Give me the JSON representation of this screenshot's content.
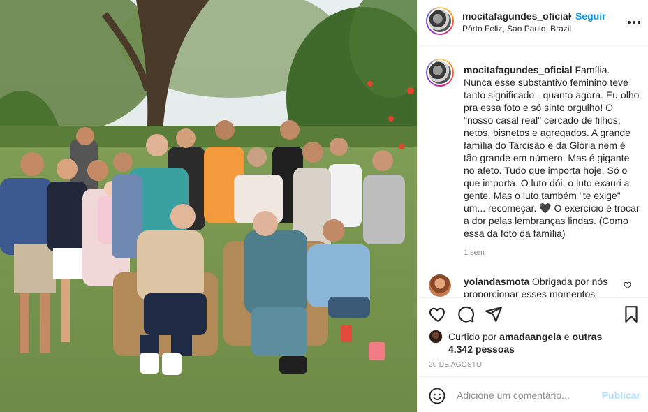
{
  "post": {
    "username": "mocitafagundes_oficial",
    "separator": "•",
    "follow_label": "Seguir",
    "location": "Pôrto Feliz, Sao Paulo, Brazil",
    "more_icon": "more-options-icon"
  },
  "caption": {
    "username": "mocitafagundes_oficial",
    "text": "Família. Nunca esse substantivo feminino teve tanto significado - quanto agora. Eu olho pra essa foto e só sinto orgulho! O \"nosso casal real\" cercado de filhos, netos, bisnetos e agregados. A grande família do Tarcisão e da Glória nem é tão grande em número. Mas é gigante no afeto. Tudo que importa hoje. Só o que importa. O luto dói, o luto exauri a gente. Mas o luto também \"te exige\" um... recomeçar. 🖤 O exercício é trocar a dor pelas lembranças lindas. (Como essa da foto da família)",
    "time": "1 sem"
  },
  "comment": {
    "username": "yolandasmota",
    "text": "Obrigada por nós proporcionar esses momentos"
  },
  "actions": {
    "like_icon": "heart-icon",
    "comment_icon": "comment-icon",
    "share_icon": "share-icon",
    "save_icon": "bookmark-icon"
  },
  "likes": {
    "prefix": "Curtido por",
    "user": "amadaangela",
    "conjunction": "e",
    "others": "outras 4.342 pessoas"
  },
  "date": "20 DE AGOSTO",
  "add_comment": {
    "placeholder": "Adicione um comentário...",
    "publish_label": "Publicar"
  },
  "colors": {
    "accent": "#0095f6",
    "publish_disabled": "#b2dffc",
    "muted": "#8e8e8e",
    "text": "#262626"
  }
}
